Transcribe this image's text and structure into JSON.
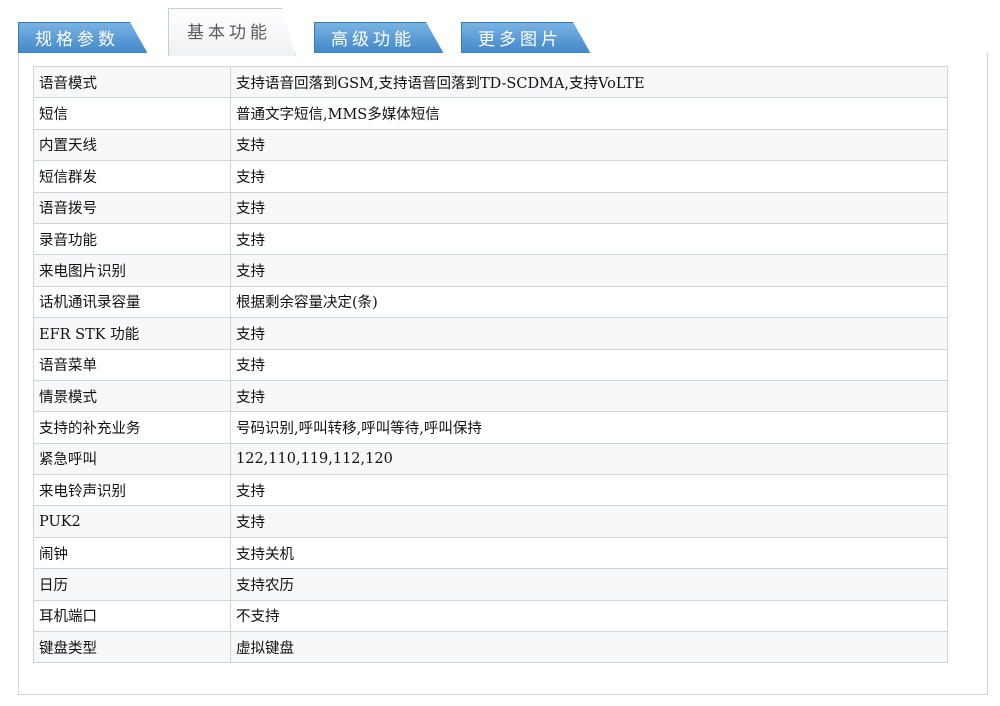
{
  "tabs": [
    {
      "label": "规格参数",
      "active": false
    },
    {
      "label": "基本功能",
      "active": true
    },
    {
      "label": "高级功能",
      "active": false
    },
    {
      "label": "更多图片",
      "active": false
    }
  ],
  "rows": [
    {
      "key": "语音模式",
      "value": "支持语音回落到GSM,支持语音回落到TD-SCDMA,支持VoLTE"
    },
    {
      "key": "短信",
      "value": "普通文字短信,MMS多媒体短信"
    },
    {
      "key": "内置天线",
      "value": "支持"
    },
    {
      "key": "短信群发",
      "value": "支持"
    },
    {
      "key": "语音拨号",
      "value": "支持"
    },
    {
      "key": "录音功能",
      "value": "支持"
    },
    {
      "key": "来电图片识别",
      "value": "支持"
    },
    {
      "key": "话机通讯录容量",
      "value": "根据剩余容量决定(条)"
    },
    {
      "key": "EFR STK 功能",
      "value": "支持"
    },
    {
      "key": "语音菜单",
      "value": "支持"
    },
    {
      "key": "情景模式",
      "value": "支持"
    },
    {
      "key": "支持的补充业务",
      "value": "号码识别,呼叫转移,呼叫等待,呼叫保持"
    },
    {
      "key": "紧急呼叫",
      "value": "122,110,119,112,120"
    },
    {
      "key": "来电铃声识别",
      "value": "支持"
    },
    {
      "key": "PUK2",
      "value": "支持"
    },
    {
      "key": "闹钟",
      "value": "支持关机"
    },
    {
      "key": "日历",
      "value": "支持农历"
    },
    {
      "key": "耳机端口",
      "value": "不支持"
    },
    {
      "key": "键盘类型",
      "value": "虚拟键盘"
    }
  ]
}
